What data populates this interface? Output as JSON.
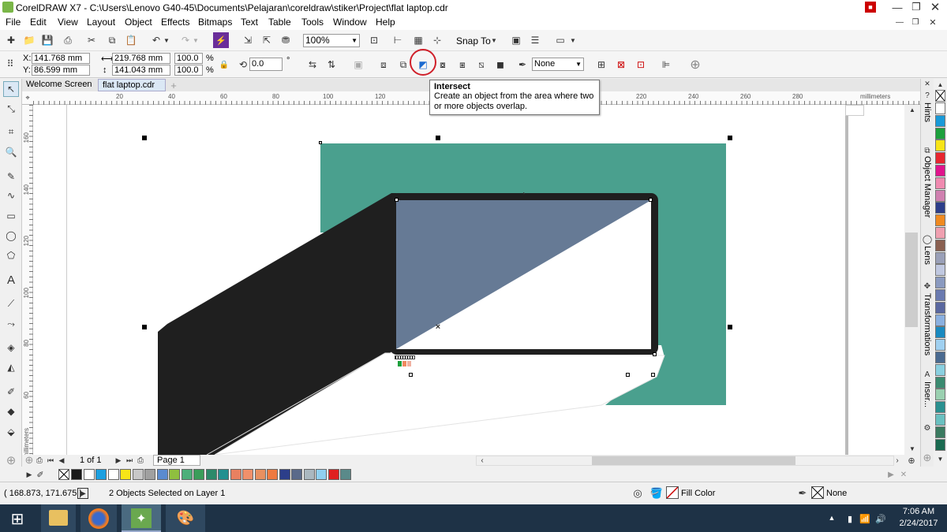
{
  "window": {
    "title": "CorelDRAW X7 - C:\\Users\\Lenovo G40-45\\Documents\\Pelajaran\\coreldraw\\stiker\\Project\\flat laptop.cdr",
    "controls": [
      "minimize",
      "restore",
      "close"
    ]
  },
  "menu": [
    "File",
    "Edit",
    "View",
    "Layout",
    "Object",
    "Effects",
    "Bitmaps",
    "Text",
    "Table",
    "Tools",
    "Window",
    "Help"
  ],
  "standard_toolbar": {
    "zoom": "100%",
    "snap_to": "Snap To"
  },
  "property_bar": {
    "x_label": "X:",
    "x_value": "141.768 mm",
    "y_label": "Y:",
    "y_value": "86.599 mm",
    "width": "219.768 mm",
    "height": "141.043 mm",
    "scale_w": "100.0",
    "scale_h": "100.0",
    "percent": "%",
    "rotation": "0.0",
    "degree": "°",
    "outline": "None"
  },
  "tooltip": {
    "title": "Intersect",
    "description": "Create an object from the area where two or more objects overlap."
  },
  "doc_tabs": [
    "Welcome Screen",
    "flat laptop.cdr"
  ],
  "ruler": {
    "h_ticks": [
      "20",
      "40",
      "60",
      "80",
      "100",
      "120",
      "220",
      "240",
      "260",
      "280"
    ],
    "unit": "millimeters",
    "v_ticks": [
      "160",
      "140",
      "120",
      "100",
      "80",
      "60"
    ],
    "v_unit": "millimeters"
  },
  "page_nav": {
    "counter": "1 of 1",
    "page_tab": "Page 1"
  },
  "dockers": [
    "Hints",
    "Object Manager",
    "Lens",
    "Transformations",
    "Inser..."
  ],
  "palette_bottom": [
    "#1a1a1a",
    "#ffffff",
    "#1ca0e0",
    "#ffffff",
    "#f7e418",
    "#c8c8c8",
    "#a0a0a0",
    "#5b8bd0",
    "#8fbf3f",
    "#4caf7a",
    "#3a9d5a",
    "#2c8a6a",
    "#229090",
    "#e98060",
    "#f0906a",
    "#e89060",
    "#ee7a40",
    "#2c3e8a",
    "#5a6a8a",
    "#aab8c0",
    "#90d0f0",
    "#e02020",
    "#5a8a8a"
  ],
  "palette_right": [
    "#ffffff",
    "#1a9ad8",
    "#1ca03c",
    "#f7e418",
    "#e8262f",
    "#e0148c",
    "#f08ab0",
    "#d080b0",
    "#2c3e8a",
    "#f08a20",
    "#f0a0b0",
    "#8a6050",
    "#9aa0b8",
    "#c0c8e0",
    "#8a9ac0",
    "#6a7ab0",
    "#5a68a0",
    "#8ab0e0",
    "#1a8ac0",
    "#a0d0f0",
    "#4a6a90",
    "#8ad0e0",
    "#3a8a70",
    "#9ad0b0",
    "#2a9090",
    "#6ac0c0",
    "#3a7a60",
    "#1a6a50"
  ],
  "status": {
    "coords": "( 168.873, 171.675 )",
    "message": "2 Objects Selected on Layer 1",
    "fill": "Fill Color",
    "outline": "None"
  },
  "taskbar": {
    "time": "7:06 AM",
    "date": "2/24/2017"
  },
  "colors": {
    "teal": "#4aa08e",
    "laptop_dark": "#1f1f1f",
    "screen_blue": "#667a95",
    "taskbar": "#1e3246"
  }
}
